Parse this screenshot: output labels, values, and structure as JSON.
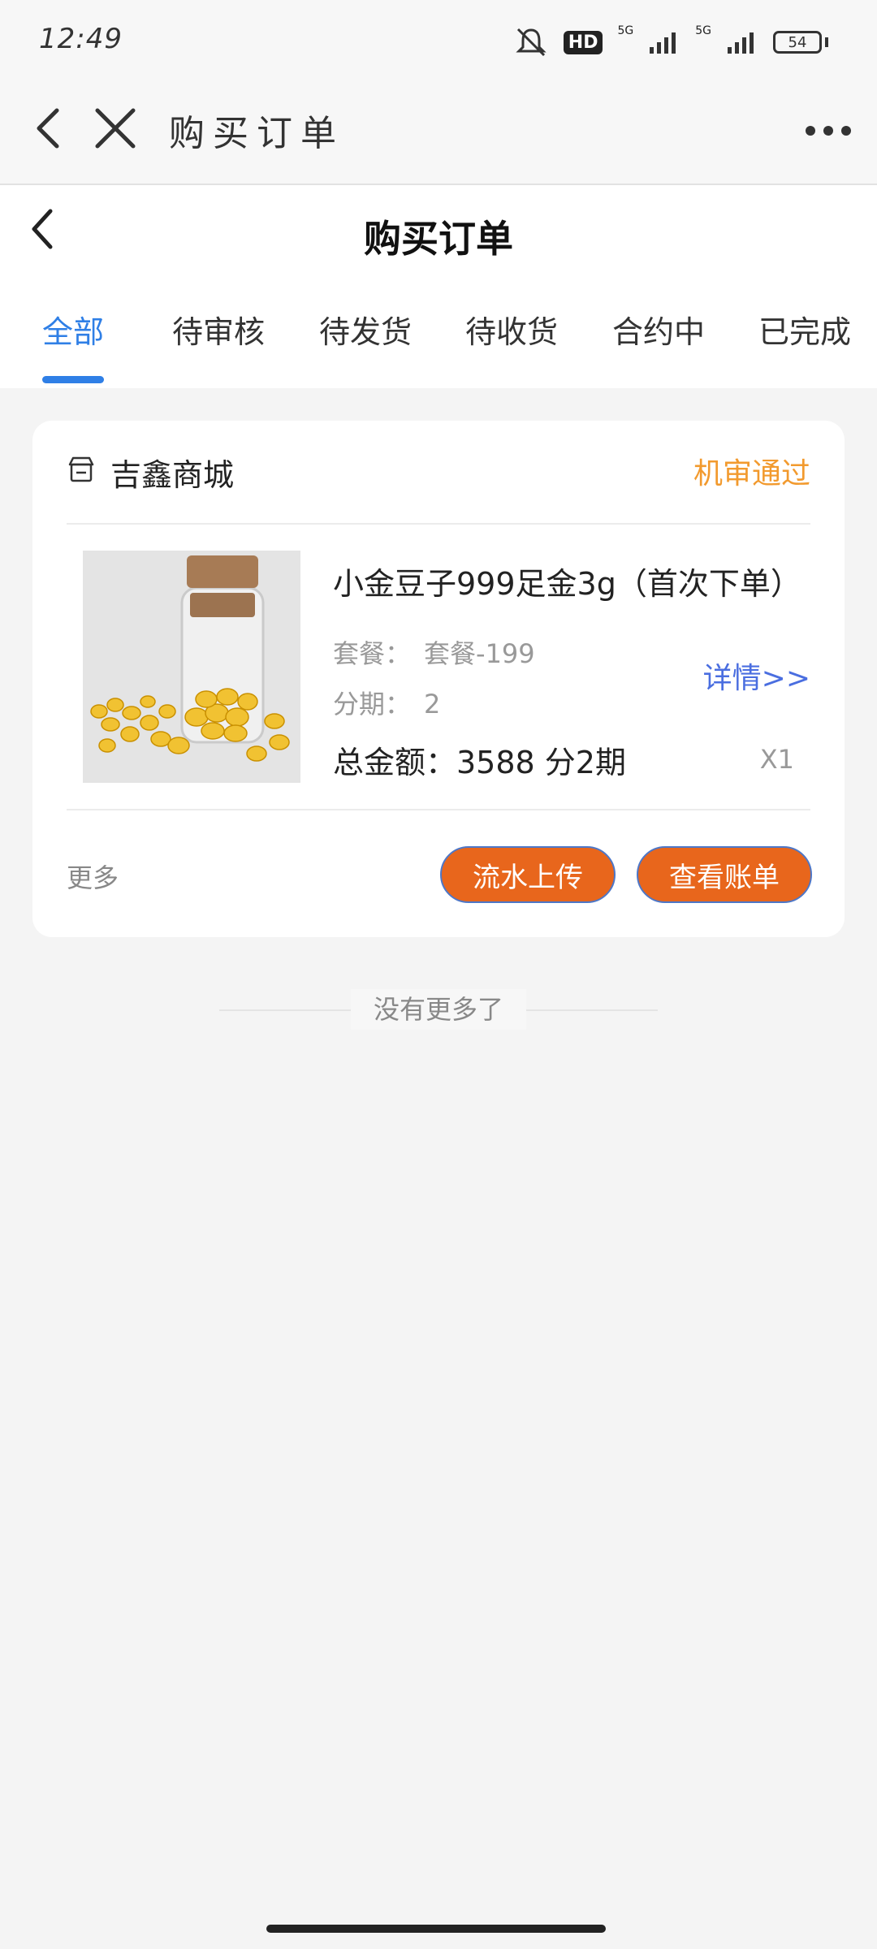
{
  "status_bar": {
    "time": "12:49",
    "network_label": "HD",
    "network_1": "5G",
    "network_2": "5G",
    "battery": "54"
  },
  "browser": {
    "title": "购买订单"
  },
  "page": {
    "title": "购买订单"
  },
  "tabs": [
    {
      "label": "全部",
      "active": true
    },
    {
      "label": "待审核"
    },
    {
      "label": "待发货"
    },
    {
      "label": "待收货"
    },
    {
      "label": "合约中"
    },
    {
      "label": "已完成"
    }
  ],
  "order": {
    "shop_name": "吉鑫商城",
    "status": "机审通过",
    "product_name": "小金豆子999足金3g（首次下单）",
    "package_label": "套餐：",
    "package_value": "套餐-199",
    "installment_label": "分期：",
    "installment_value": "2",
    "detail_link": "详情>>",
    "total": "总金额：3588 分2期",
    "quantity": "X1",
    "more": "更多",
    "btn_upload": "流水上传",
    "btn_bill": "查看账单"
  },
  "footer": {
    "end_text": "没有更多了"
  },
  "colors": {
    "accent": "#2f7fe6",
    "status_orange": "#f29a2e",
    "button_orange": "#e8661c",
    "link_blue": "#4a6ee0"
  }
}
